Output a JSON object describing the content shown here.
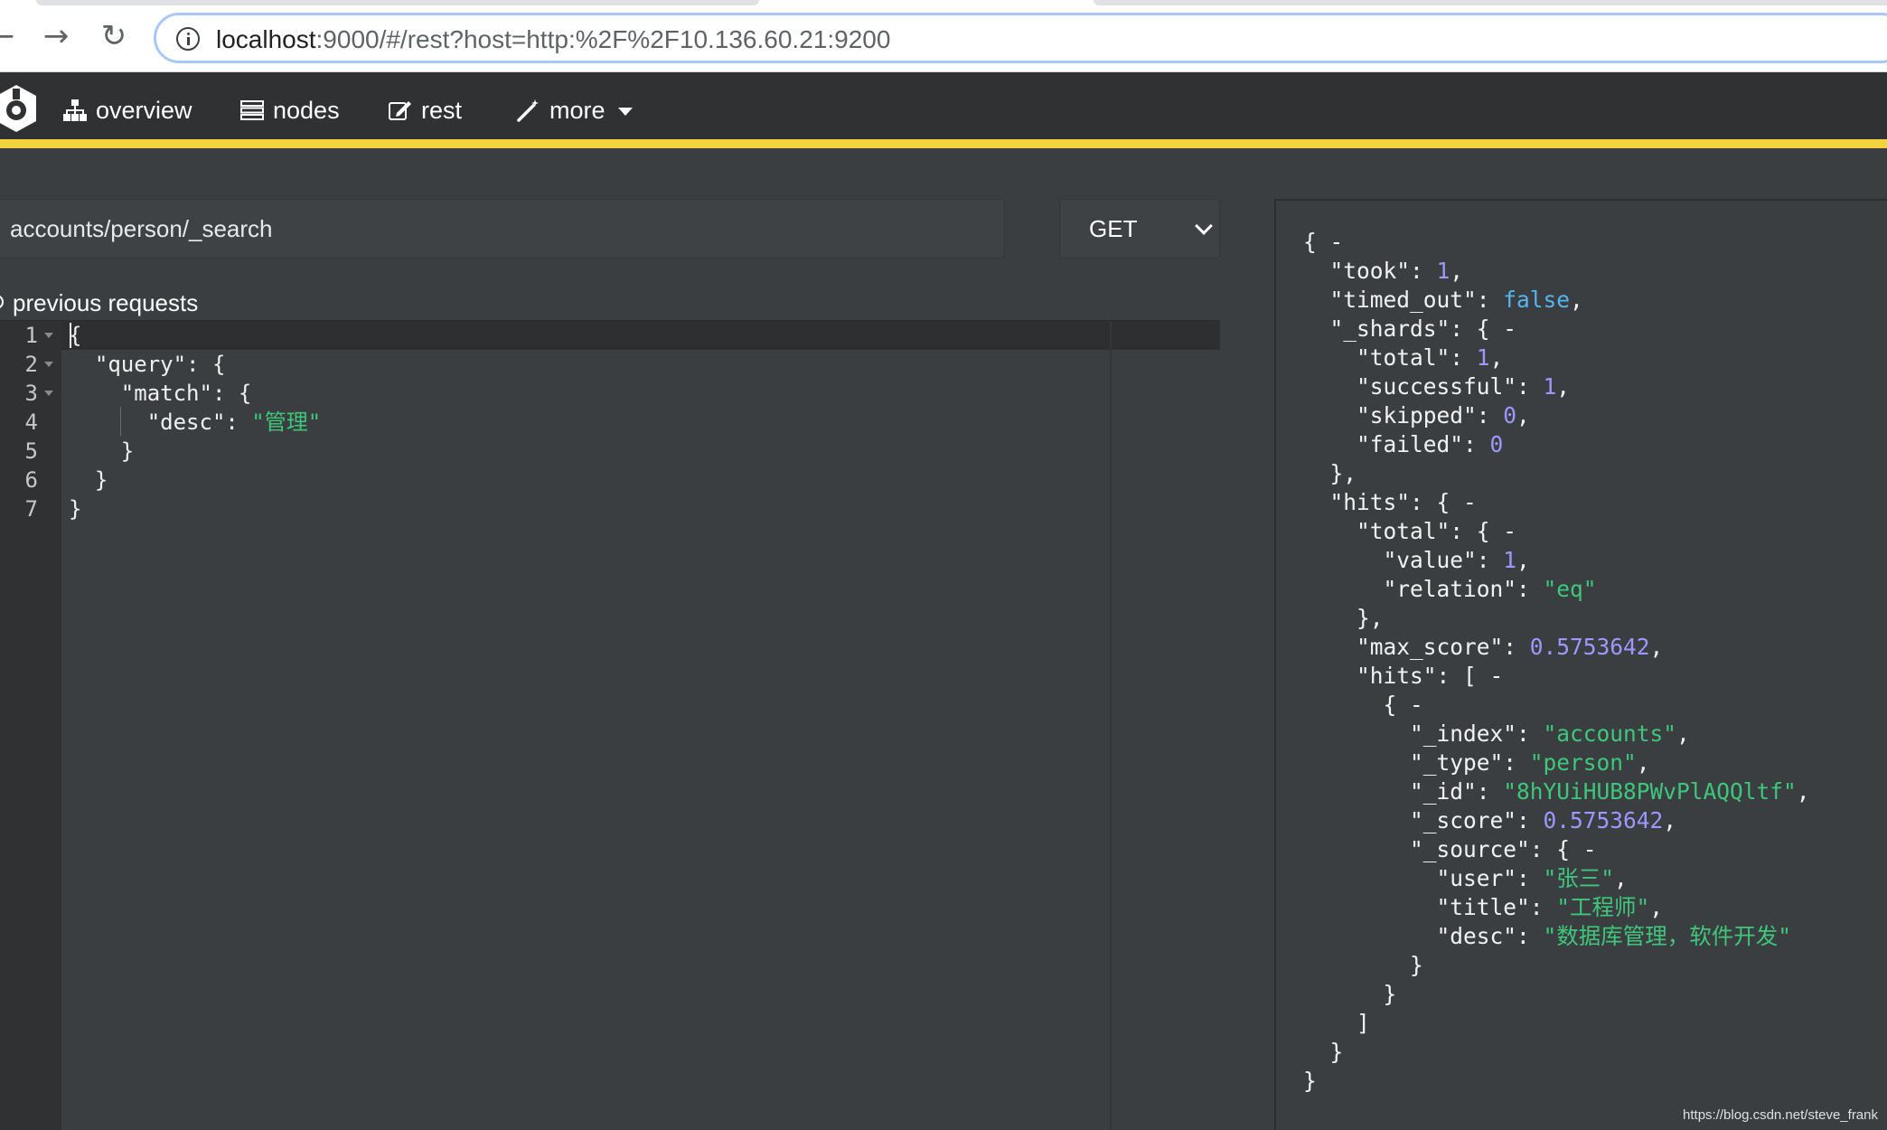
{
  "browser": {
    "back_icon": "back-arrow-icon",
    "forward_icon": "forward-arrow-icon",
    "reload_icon": "reload-icon",
    "url_host": "localhost",
    "url_rest": ":9000/#/rest?host=http:%2F%2F10.136.60.21:9200"
  },
  "nav": {
    "items": [
      {
        "label": "overview",
        "icon": "sitemap-icon"
      },
      {
        "label": "nodes",
        "icon": "server-icon"
      },
      {
        "label": "rest",
        "icon": "edit-icon"
      },
      {
        "label": "more",
        "icon": "magic-wand-icon"
      }
    ],
    "accent_color": "#f0d33e"
  },
  "request": {
    "path": "accounts/person/_search",
    "method": "GET",
    "previous_requests_label": "previous requests"
  },
  "editor": {
    "line_numbers": [
      "1",
      "2",
      "3",
      "4",
      "5",
      "6",
      "7"
    ],
    "lines": [
      {
        "text": "{"
      },
      {
        "text": "  \"query\": {"
      },
      {
        "text": "    \"match\": {"
      },
      {
        "key": "      \"desc\": ",
        "value": "\"管理\""
      },
      {
        "text": "    }"
      },
      {
        "text": "  }"
      },
      {
        "text": "}"
      }
    ]
  },
  "response": {
    "lines": [
      "{ -",
      "  \"took\": 1,",
      "  \"timed_out\": false,",
      "  \"_shards\": { -",
      "    \"total\": 1,",
      "    \"successful\": 1,",
      "    \"skipped\": 0,",
      "    \"failed\": 0",
      "  },",
      "  \"hits\": { -",
      "    \"total\": { -",
      "      \"value\": 1,",
      "      \"relation\": \"eq\"",
      "    },",
      "    \"max_score\": 0.5753642,",
      "    \"hits\": [ -",
      "      { -",
      "        \"_index\": \"accounts\",",
      "        \"_type\": \"person\",",
      "        \"_id\": \"8hYUiHUB8PWvPlAQQltf\",",
      "        \"_score\": 0.5753642,",
      "        \"_source\": { -",
      "          \"user\": \"张三\",",
      "          \"title\": \"工程师\",",
      "          \"desc\": \"数据库管理，软件开发\"",
      "        }",
      "      }",
      "    ]",
      "  }",
      "}"
    ]
  },
  "watermark": "https://blog.csdn.net/steve_frank"
}
